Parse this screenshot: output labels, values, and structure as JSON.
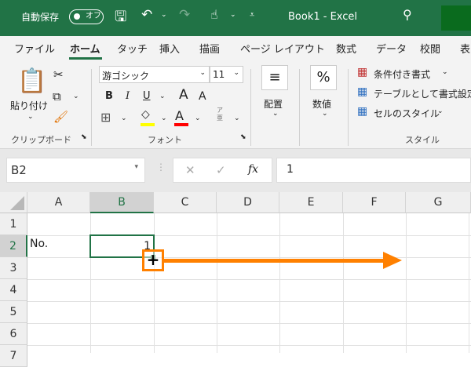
{
  "titlebar": {
    "autosave_label": "自動保存",
    "autosave_state": "オフ",
    "title": "Book1  -  Excel"
  },
  "tabs": [
    "ファイル",
    "ホーム",
    "タッチ",
    "挿入",
    "描画",
    "ページ レイアウト",
    "数式",
    "データ",
    "校閲",
    "表"
  ],
  "active_tab": "ホーム",
  "ribbon": {
    "clipboard": {
      "paste": "貼り付け",
      "group": "クリップボード"
    },
    "font": {
      "name": "游ゴシック",
      "size": "11",
      "bold": "B",
      "italic": "I",
      "underline": "U",
      "grow": "A",
      "shrink": "A",
      "font_color": "A",
      "phonetic": "ア\n亜",
      "group": "フォント"
    },
    "alignment": {
      "label": "配置"
    },
    "number": {
      "label": "数値",
      "icon_text": "%"
    },
    "styles": {
      "conditional": "条件付き書式",
      "table": "テーブルとして書式設定",
      "cell": "セルのスタイル",
      "group": "スタイル"
    }
  },
  "accent_colors": {
    "fill": "#ffff00",
    "font": "#ff0000",
    "title": "#217346",
    "annotation": "#ff8000"
  },
  "formula_bar": {
    "name_box": "B2",
    "fx": "fx",
    "value": "1",
    "cancel": "✕",
    "enter": "✓"
  },
  "grid": {
    "columns": [
      "A",
      "B",
      "C",
      "D",
      "E",
      "F",
      "G"
    ],
    "rows": [
      "1",
      "2",
      "3",
      "4",
      "5",
      "6",
      "7"
    ],
    "cells": {
      "A2": "No.",
      "B2": "1"
    },
    "selected": "B2"
  },
  "annotation": {
    "cursor": "+"
  }
}
